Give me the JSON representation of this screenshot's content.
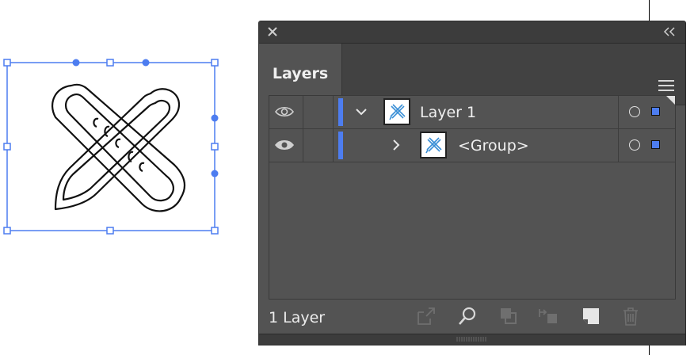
{
  "panel": {
    "tab_label": "Layers",
    "footer_count": "1 Layer"
  },
  "layers": [
    {
      "name": "Layer 1",
      "expanded": true,
      "visible": true,
      "color": "#4d7df0"
    },
    {
      "name": "<Group>",
      "expanded": false,
      "visible": true,
      "color": "#4d7df0"
    }
  ],
  "colors": {
    "panel_bg": "#535353",
    "title_bg": "#3c3c3c",
    "layer_color": "#4d7df0",
    "selection": "#4d7df0"
  },
  "icons": {
    "close": "close-icon",
    "collapse": "double-chevron-left-icon",
    "menu": "hamburger-menu-icon",
    "visibility": "eye-icon",
    "expand": "chevron-icon",
    "target": "target-circle-icon",
    "footer": [
      "export-icon",
      "search-icon",
      "clipping-mask-icon",
      "move-to-layer-icon",
      "new-layer-icon",
      "trash-icon"
    ]
  }
}
